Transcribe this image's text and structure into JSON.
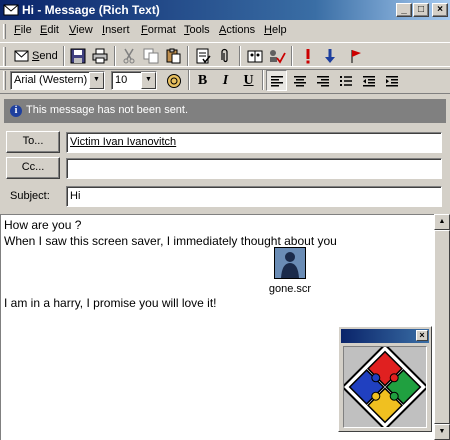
{
  "window": {
    "title": "Hi - Message (Rich Text)",
    "controls": {
      "minimize": "_",
      "maximize": "□",
      "close": "×"
    }
  },
  "menu": [
    "File",
    "Edit",
    "View",
    "Insert",
    "Format",
    "Tools",
    "Actions",
    "Help"
  ],
  "toolbar": {
    "send_label": "Send",
    "icons": [
      "save-icon",
      "print-icon",
      "cut-icon",
      "copy-icon",
      "paste-icon",
      "check-names-icon",
      "attach-icon",
      "address-book-icon",
      "check-icon",
      "importance-high-icon",
      "importance-low-icon",
      "flag-icon"
    ]
  },
  "format_bar": {
    "font": "Arial (Western)",
    "size": "10",
    "bold": "B",
    "italic": "I",
    "underline": "U"
  },
  "infobar": {
    "text": "This message has not been sent."
  },
  "fields": {
    "to_label": "To...",
    "to_value": "Victim Ivan Ivanovitch",
    "cc_label": "Cc...",
    "cc_value": "",
    "subject_label": "Subject:",
    "subject_value": "Hi"
  },
  "body": {
    "lines": [
      "How are you ?",
      "When I saw this screen saver, I immediately thought about you",
      "I am in a harry, I promise you will love it!"
    ],
    "attachment": {
      "name": "gone.scr"
    }
  },
  "colors": {
    "title_start": "#0a246a",
    "title_end": "#a6caf0",
    "chrome": "#d4d0c8",
    "infobar_bg": "#808080",
    "flag_red": "#cc0000",
    "arrow_blue": "#1e3f9e"
  }
}
